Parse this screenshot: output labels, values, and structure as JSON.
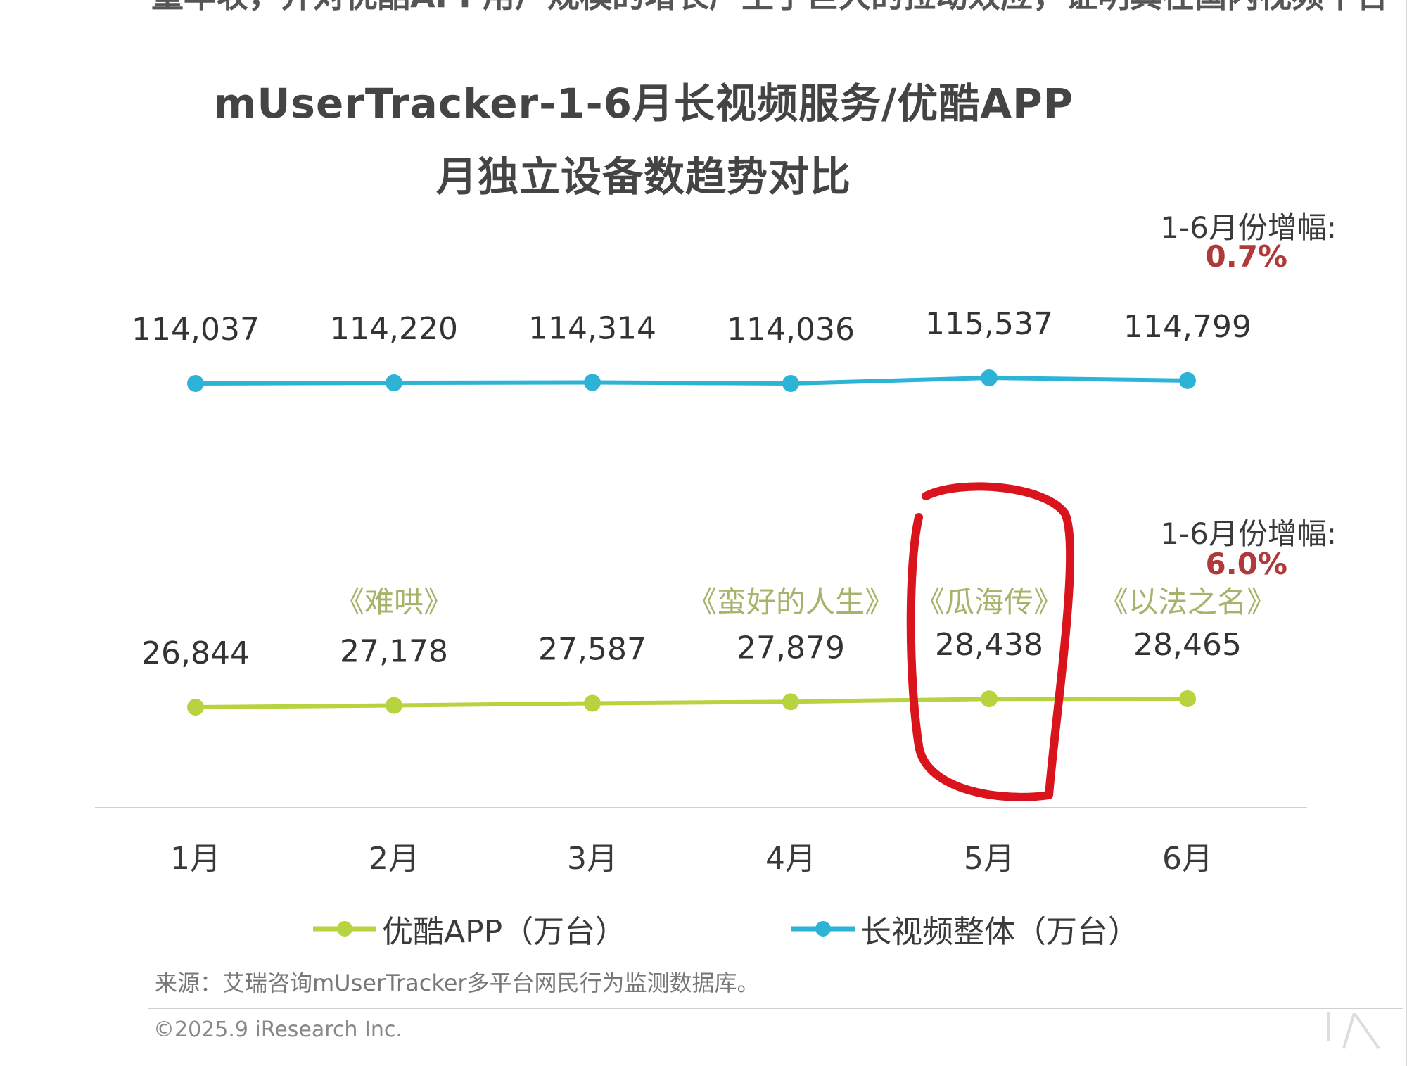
{
  "top_text": "量年收，并对优酷APP用户规模的增长产生了巨大的拉动效应，证明其在国内视频平台",
  "chart_data": {
    "type": "line",
    "title": "mUserTracker-1-6月长视频服务/优酷APP",
    "subtitle": "月独立设备数趋势对比",
    "categories": [
      "1月",
      "2月",
      "3月",
      "4月",
      "5月",
      "6月"
    ],
    "series": [
      {
        "name": "长视频整体（万台）",
        "color": "#2db3d6",
        "values": [
          114037,
          114220,
          114314,
          114036,
          115537,
          114799
        ],
        "labels": [
          "114,037",
          "114,220",
          "114,314",
          "114,036",
          "115,537",
          "114,799"
        ],
        "growth_label": "1-6月份增幅:",
        "growth_value": "0.7%"
      },
      {
        "name": "优酷APP（万台）",
        "color": "#b7d340",
        "values": [
          26844,
          27178,
          27587,
          27879,
          28438,
          28465
        ],
        "labels": [
          "26,844",
          "27,178",
          "27,587",
          "27,879",
          "28,438",
          "28,465"
        ],
        "growth_label": "1-6月份增幅:",
        "growth_value": "6.0%"
      }
    ],
    "annotations": [
      {
        "category_index": 1,
        "text": "《难哄》"
      },
      {
        "category_index": 3,
        "text": "《蛮好的人生》"
      },
      {
        "category_index": 4,
        "text": "《瓜海传》"
      },
      {
        "category_index": 5,
        "text": "《以法之名》"
      }
    ],
    "highlight": {
      "category_index": 4,
      "color": "#d9141c"
    },
    "grid": false,
    "legend_position": "bottom"
  },
  "source_text": "来源：艾瑞咨询mUserTracker多平台网民行为监测数据库。",
  "copyright_text": "©2025.9 iResearch Inc.",
  "colors": {
    "accent_red": "#b03a3a",
    "annotation": "#a8b26a",
    "axis": "#cfcfcf"
  }
}
